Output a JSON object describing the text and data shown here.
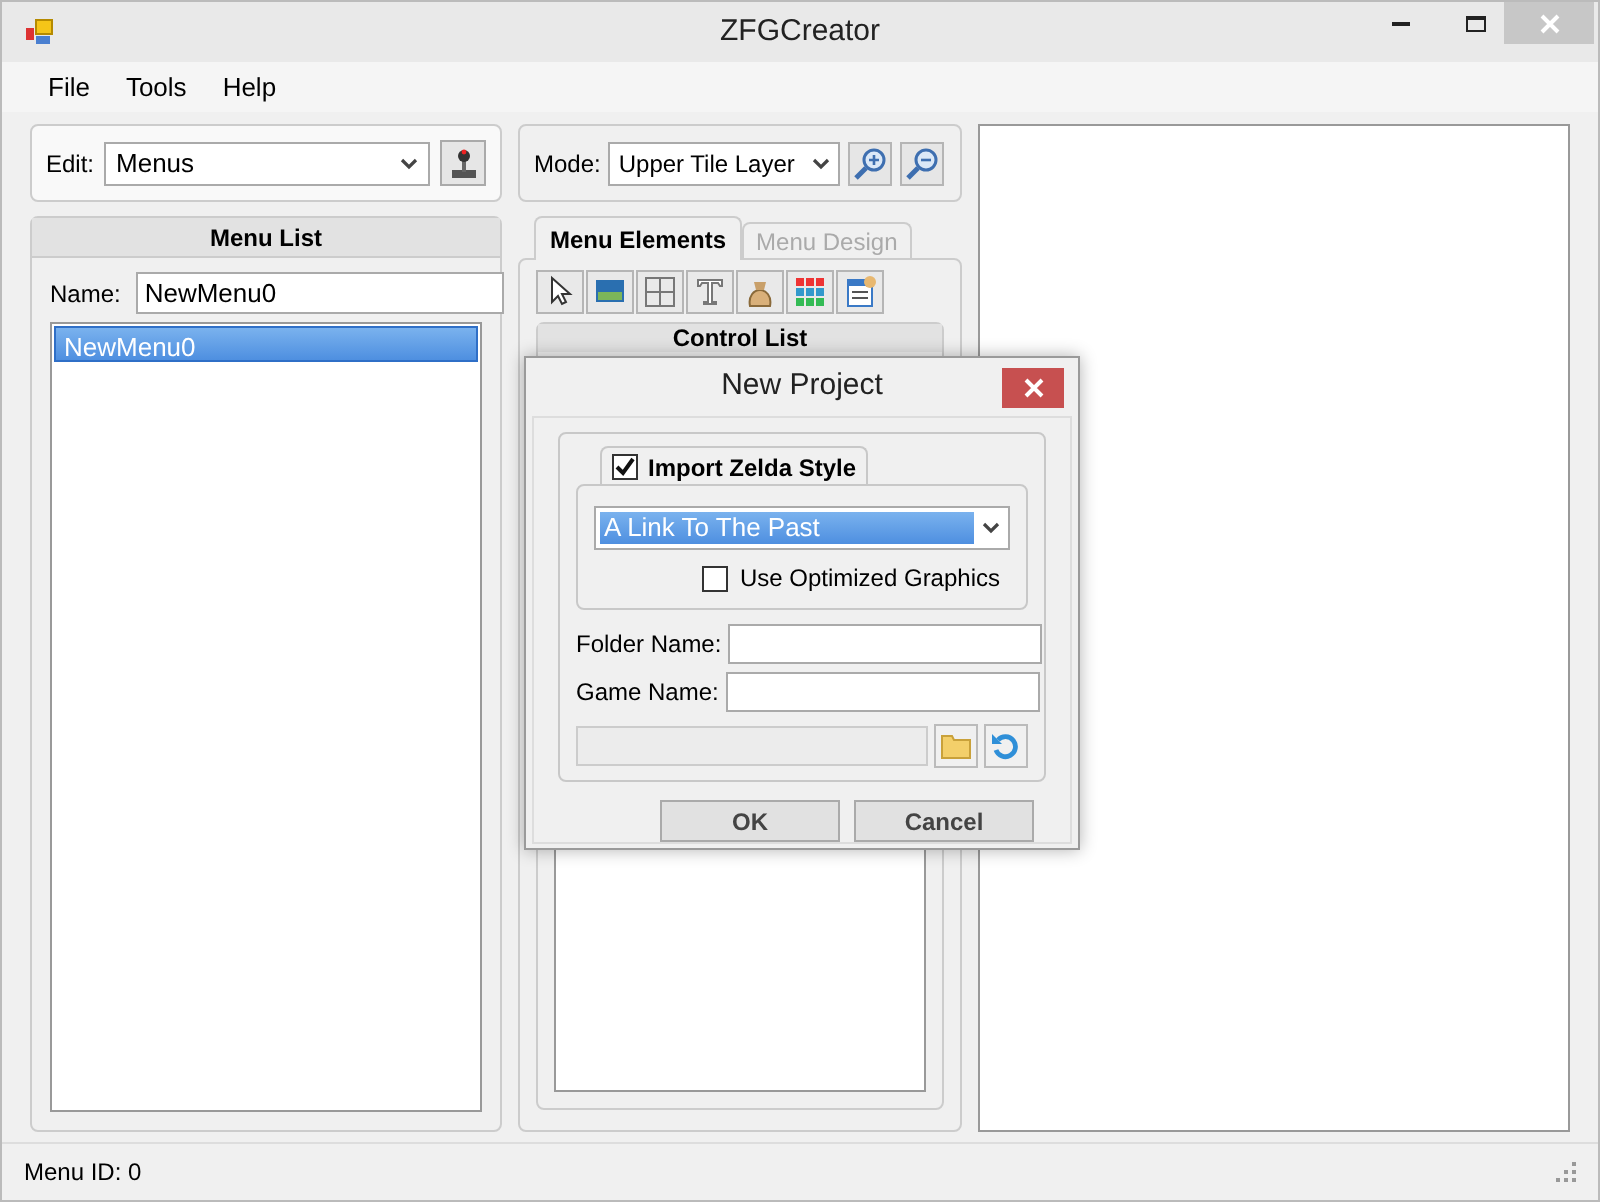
{
  "window": {
    "title": "ZFGCreator"
  },
  "menu": [
    "File",
    "Tools",
    "Help"
  ],
  "edit": {
    "label": "Edit:",
    "value": "Menus"
  },
  "mode": {
    "label": "Mode:",
    "value": "Upper Tile Layer"
  },
  "menu_list": {
    "title": "Menu List",
    "name_label": "Name:",
    "name_value": "NewMenu0",
    "items": [
      {
        "label": "NewMenu0",
        "selected": true
      }
    ]
  },
  "tabs": [
    {
      "label": "Menu Elements",
      "selected": true
    },
    {
      "label": "Menu Design",
      "selected": false
    }
  ],
  "control_list": {
    "title": "Control List"
  },
  "dialog": {
    "title": "New Project",
    "import": {
      "label": "Import Zelda Style",
      "checked": true
    },
    "style_value": "A Link To The Past",
    "optimized": {
      "label": "Use Optimized Graphics",
      "checked": false
    },
    "folder_label": "Folder Name:",
    "game_label": "Game Name:",
    "buttons": [
      "OK",
      "Cancel"
    ]
  },
  "status_bar": "Menu ID: 0"
}
